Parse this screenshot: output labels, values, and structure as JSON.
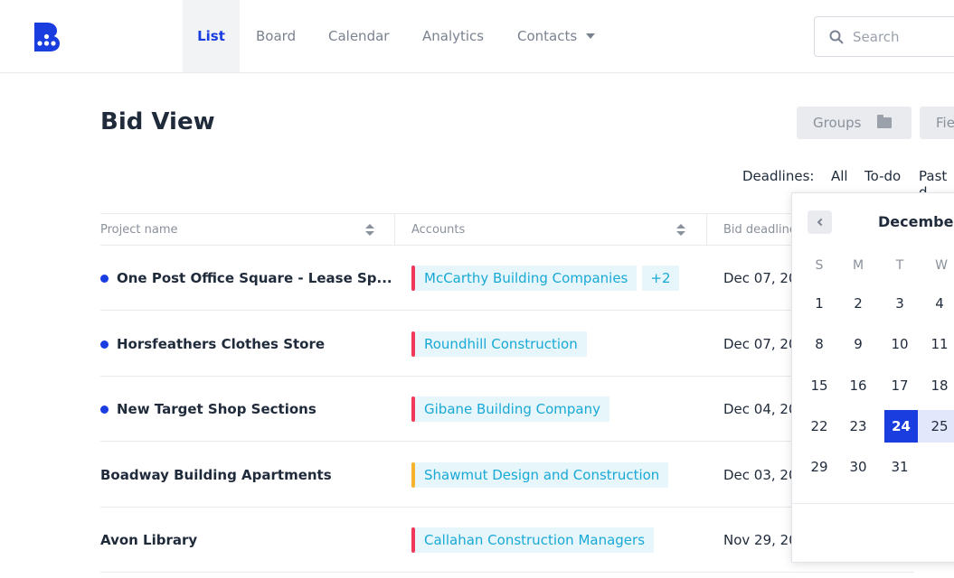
{
  "nav": {
    "tabs": [
      {
        "label": "List"
      },
      {
        "label": "Board"
      },
      {
        "label": "Calendar"
      },
      {
        "label": "Analytics"
      },
      {
        "label": "Contacts"
      }
    ],
    "search_placeholder": "Search"
  },
  "page": {
    "title": "Bid View",
    "groups_label": "Groups",
    "fields_label": "Fie"
  },
  "deadlines": {
    "label": "Deadlines:",
    "options": [
      "All",
      "To-do",
      "Past d"
    ]
  },
  "table": {
    "headers": [
      "Project name",
      "Accounts",
      "Bid deadline"
    ],
    "rows": [
      {
        "project": "One Post Office Square - Lease Sp...",
        "unread": true,
        "account": "McCarthy Building Companies",
        "extra": "+2",
        "status_color": "#f2385a",
        "deadline": "Dec 07, 20"
      },
      {
        "project": "Horsfeathers Clothes Store",
        "unread": true,
        "account": "Roundhill Construction",
        "extra": "",
        "status_color": "#f2385a",
        "deadline": "Dec 07, 20"
      },
      {
        "project": "New Target Shop Sections",
        "unread": true,
        "account": "Gibane Building Company",
        "extra": "",
        "status_color": "#f2385a",
        "deadline": "Dec 04, 20"
      },
      {
        "project": "Boadway Building Apartments",
        "unread": false,
        "account": "Shawmut Design and Construction",
        "extra": "",
        "status_color": "#f7b230",
        "deadline": "Dec 03, 20"
      },
      {
        "project": "Avon Library",
        "unread": false,
        "account": "Callahan Construction Managers",
        "extra": "",
        "status_color": "#f2385a",
        "deadline": "Nov 29, 20"
      }
    ]
  },
  "calendar": {
    "month": "December",
    "weekdays": [
      "S",
      "M",
      "T",
      "W"
    ],
    "weeks": [
      [
        "1",
        "2",
        "3",
        "4"
      ],
      [
        "8",
        "9",
        "10",
        "11"
      ],
      [
        "15",
        "16",
        "17",
        "18"
      ],
      [
        "22",
        "23",
        "24",
        "25"
      ],
      [
        "29",
        "30",
        "31",
        ""
      ]
    ],
    "selected_day": "24",
    "range_day": "25"
  },
  "colors": {
    "accent": "#1a3de0",
    "chip_text": "#18a9d6",
    "chip_bg": "#e7f6fb"
  }
}
